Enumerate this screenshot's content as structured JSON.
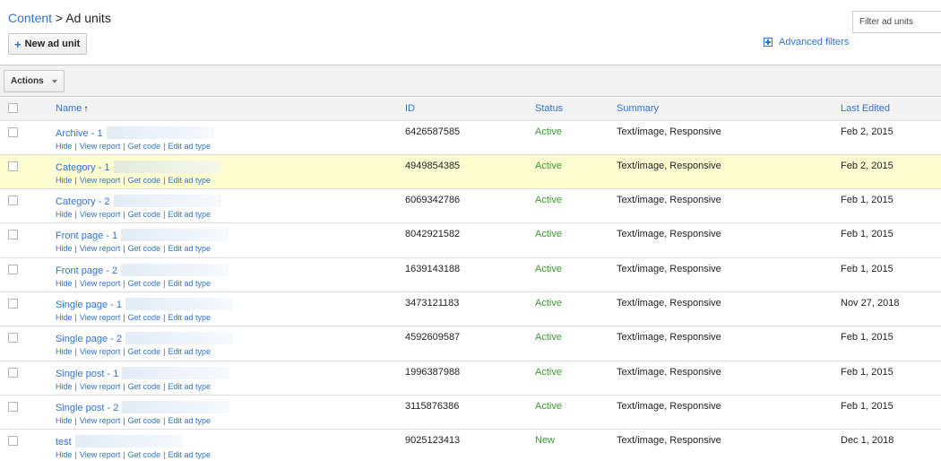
{
  "breadcrumb": {
    "link": "Content",
    "separator": " > ",
    "current": "Ad units"
  },
  "toolbar": {
    "new_ad_unit_label": "New ad unit",
    "plus_icon": "+"
  },
  "filter": {
    "placeholder": "Filter ad units",
    "value": ""
  },
  "advanced_filters_label": "Advanced filters",
  "actions_label": "Actions",
  "table": {
    "columns": {
      "name": "Name",
      "sort_arrow": "↑",
      "id": "ID",
      "status": "Status",
      "summary": "Summary",
      "last_edited": "Last Edited"
    },
    "row_actions": {
      "hide": "Hide",
      "view_report": "View report",
      "get_code": "Get code",
      "edit_ad_type": "Edit ad type",
      "separator": "|"
    },
    "rows": [
      {
        "name": "Archive - 1",
        "id": "6426587585",
        "status": "Active",
        "summary": "Text/image, Responsive",
        "last_edited": "Feb 2, 2015",
        "highlighted": false
      },
      {
        "name": "Category - 1",
        "id": "4949854385",
        "status": "Active",
        "summary": "Text/image, Responsive",
        "last_edited": "Feb 2, 2015",
        "highlighted": true
      },
      {
        "name": "Category - 2",
        "id": "6069342786",
        "status": "Active",
        "summary": "Text/image, Responsive",
        "last_edited": "Feb 1, 2015",
        "highlighted": false
      },
      {
        "name": "Front page - 1",
        "id": "8042921582",
        "status": "Active",
        "summary": "Text/image, Responsive",
        "last_edited": "Feb 1, 2015",
        "highlighted": false
      },
      {
        "name": "Front page - 2",
        "id": "1639143188",
        "status": "Active",
        "summary": "Text/image, Responsive",
        "last_edited": "Feb 1, 2015",
        "highlighted": false
      },
      {
        "name": "Single page - 1",
        "id": "3473121183",
        "status": "Active",
        "summary": "Text/image, Responsive",
        "last_edited": "Nov 27, 2018",
        "highlighted": false
      },
      {
        "name": "Single page - 2",
        "id": "4592609587",
        "status": "Active",
        "summary": "Text/image, Responsive",
        "last_edited": "Feb 1, 2015",
        "highlighted": false
      },
      {
        "name": "Single post - 1",
        "id": "1996387988",
        "status": "Active",
        "summary": "Text/image, Responsive",
        "last_edited": "Feb 1, 2015",
        "highlighted": false
      },
      {
        "name": "Single post - 2",
        "id": "3115876386",
        "status": "Active",
        "summary": "Text/image, Responsive",
        "last_edited": "Feb 1, 2015",
        "highlighted": false
      },
      {
        "name": "test",
        "id": "9025123413",
        "status": "New",
        "summary": "Text/image, Responsive",
        "last_edited": "Dec 1, 2018",
        "highlighted": false
      }
    ]
  },
  "colors": {
    "link": "#2f73d2",
    "status_green": "#3b9a2e",
    "row_highlight": "#fdfdd2",
    "header_bg": "#f2f2f2"
  }
}
